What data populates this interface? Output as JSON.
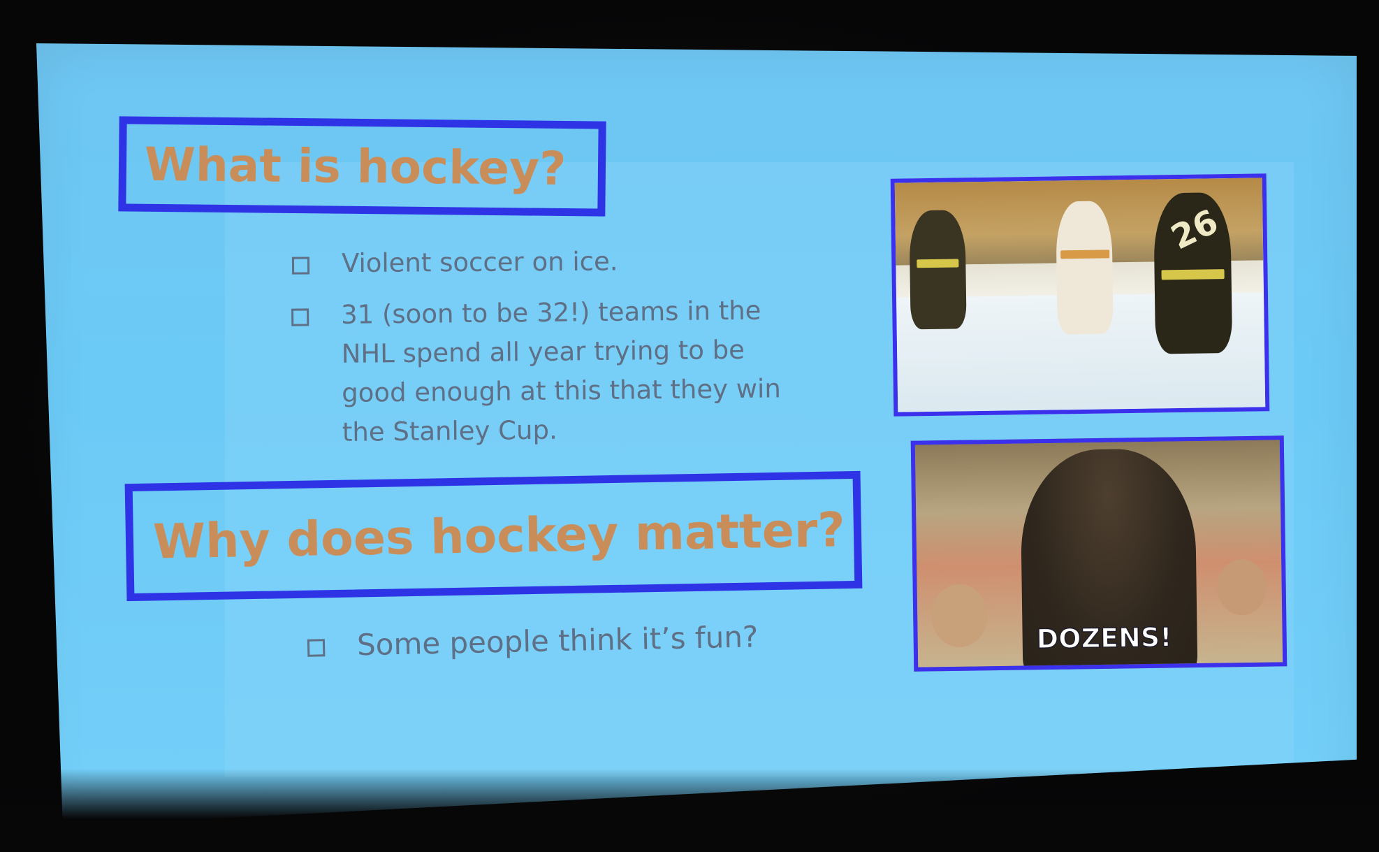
{
  "slide": {
    "heading1": "What is hockey?",
    "heading2": "Why does hockey matter?",
    "bullets_section1": [
      "Violent soccer on ice.",
      "31 (soon to be 32!) teams in the NHL spend all year trying to be good enough at this that they win the Stanley Cup."
    ],
    "bullets_section2": [
      "Some people think it’s fun?"
    ],
    "image1": {
      "jersey_number": "26"
    },
    "image2": {
      "caption": "DOZENS!"
    }
  },
  "colors": {
    "screen_blue": "#6ec6f2",
    "heading_border": "#2f33e6",
    "heading_text": "#c98d5a",
    "body_text": "#5e6f86"
  }
}
